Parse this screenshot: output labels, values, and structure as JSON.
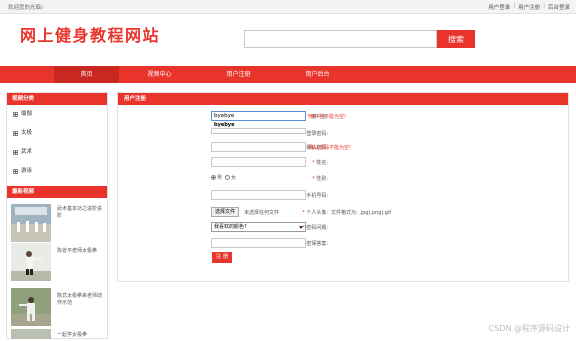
{
  "topbar": {
    "welcome": "欢迎您的光临!",
    "links": [
      "用户登录",
      "用户注册",
      "后台登录"
    ]
  },
  "header": {
    "logo": "网上健身教程网站",
    "search_placeholder": "",
    "search_button": "搜索"
  },
  "nav": {
    "items": [
      "首页",
      "视频中心",
      "用户注册",
      "用户后台"
    ],
    "active_index": 0
  },
  "sidebar": {
    "category_title": "视频分类",
    "categories": [
      "瑜伽",
      "太极",
      "武术",
      "游泳"
    ],
    "latest_title": "最新视频",
    "videos": [
      "武术基本功之进阶进阶",
      "陈省平老师太极拳",
      "陈式太极拳来老师动作示范",
      "一起学太极拳"
    ]
  },
  "panel": {
    "title": "用户注册",
    "fields": {
      "username_label": "用户名:",
      "username_value": "byebye",
      "username_error": "用户名不能为空!",
      "username_suggest": "byebye",
      "password_label": "登录密码:",
      "confirm_label": "确认密码:",
      "confirm_error": "确认密码不能为空!",
      "name_label": "姓名:",
      "gender_label": "性别:",
      "gender_male": "男",
      "gender_female": "女",
      "phone_label": "手机号码:",
      "avatar_label": "个人头像:",
      "avatar_button": "选择文件",
      "avatar_status": "未选择任何文件",
      "avatar_hint": "文件格式为: .jpg|.png|.gif",
      "question_label": "密码问题:",
      "question_value": "我喜欢的颜色?",
      "answer_label": "密保答案:"
    },
    "submit_label": "注 册"
  },
  "watermark": "CSDN @程序源码设计",
  "colors": {
    "accent": "#e8342a",
    "accent_dark": "#c8281f"
  }
}
